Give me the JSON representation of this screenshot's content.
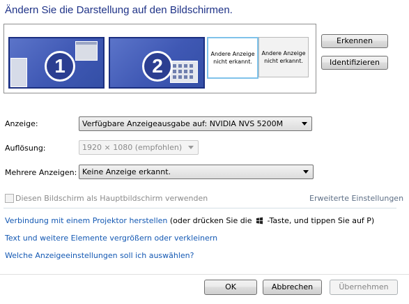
{
  "title": "Ändern Sie die Darstellung auf den Bildschirmen.",
  "monitors": [
    {
      "number": "1"
    },
    {
      "number": "2"
    }
  ],
  "not_detected": [
    "Andere Anzeige nicht erkannt.",
    "Andere Anzeige nicht erkannt."
  ],
  "side_buttons": {
    "detect": "Erkennen",
    "identify": "Identifizieren"
  },
  "fields": {
    "display_label": "Anzeige:",
    "display_value": "Verfügbare Anzeigeausgabe auf: NVIDIA NVS 5200M",
    "resolution_label": "Auflösung:",
    "resolution_value": "1920 × 1080 (empfohlen)",
    "multiple_label": "Mehrere Anzeigen:",
    "multiple_value": "Keine Anzeige erkannt."
  },
  "checkbox": {
    "label": "Diesen Bildschirm als Hauptbildschirm verwenden",
    "checked": false,
    "enabled": false
  },
  "advanced_link": "Erweiterte Einstellungen",
  "links": {
    "projector": "Verbindung mit einem Projektor herstellen",
    "projector_hint_before": " (oder drücken Sie die ",
    "projector_hint_after": " -Taste, und tippen Sie auf P)",
    "text_size": "Text und weitere Elemente vergrößern oder verkleinern",
    "which_settings": "Welche Anzeigeeinstellungen soll ich auswählen?"
  },
  "icons": {
    "windows_key": "windows-logo-icon"
  },
  "footer": {
    "ok": "OK",
    "cancel": "Abbrechen",
    "apply": "Übernehmen"
  },
  "colors": {
    "title": "#1e3287",
    "link": "#1358b3",
    "monitor_fill": "#3f58b4",
    "selected_border": "#7fc2ea"
  }
}
